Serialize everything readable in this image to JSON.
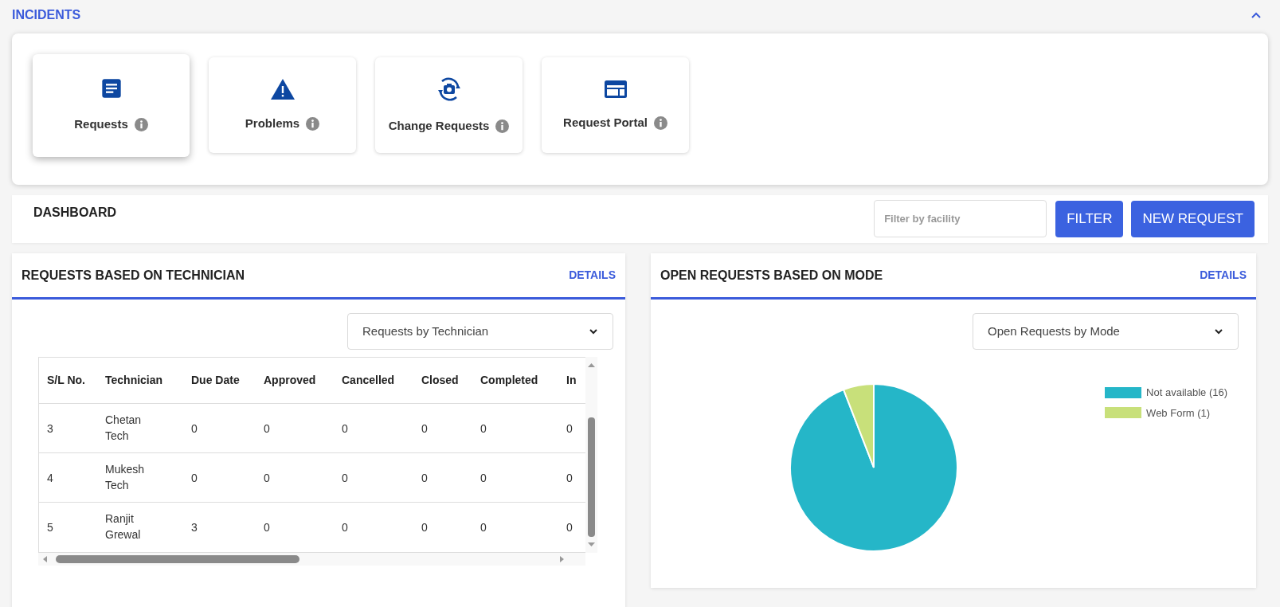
{
  "section": {
    "title": "INCIDENTS",
    "expanded": true
  },
  "tiles": [
    {
      "label": "Requests",
      "selected": true
    },
    {
      "label": "Problems",
      "selected": false
    },
    {
      "label": "Change Requests",
      "selected": false
    },
    {
      "label": "Request Portal",
      "selected": false
    }
  ],
  "dashboard": {
    "title": "DASHBOARD",
    "filter": {
      "placeholder": "Filter by facility"
    },
    "buttons": [
      "FILTER",
      "NEW REQUEST"
    ]
  },
  "technician_panel": {
    "title": "REQUESTS BASED ON TECHNICIAN",
    "link": "DETAILS",
    "select": {
      "value": "Requests by Technician"
    },
    "table": {
      "columns": [
        "S/L No.",
        "Technician",
        "Due Date",
        "Approved",
        "Cancelled",
        "Closed",
        "Completed",
        "In"
      ],
      "rows": [
        [
          "3",
          "Chetan Tech",
          "0",
          "0",
          "0",
          "0",
          "0",
          "0"
        ],
        [
          "4",
          "Mukesh Tech",
          "0",
          "0",
          "0",
          "0",
          "0",
          "0"
        ],
        [
          "5",
          "Ranjit Grewal",
          "3",
          "0",
          "0",
          "0",
          "0",
          "0"
        ]
      ]
    }
  },
  "mode_panel": {
    "title": "OPEN REQUESTS BASED ON MODE",
    "link": "DETAILS",
    "select": {
      "value": "Open Requests by Mode"
    },
    "chart_data": {
      "type": "pie",
      "categories": [
        "Not available (16)",
        "Web Form (1)"
      ],
      "values": [
        16,
        1
      ],
      "legend": "right",
      "colors": [
        "#25b6c8",
        "#c8e07a"
      ]
    }
  }
}
